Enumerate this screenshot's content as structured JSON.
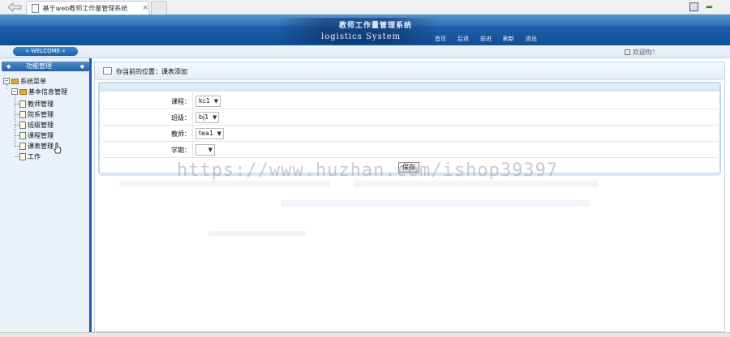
{
  "browser": {
    "tab_title": "基于web教师工作量管理系统",
    "tab_close": "×"
  },
  "header": {
    "title": "教师工作量管理系统",
    "subtitle": "logistics System",
    "nav": [
      "首页",
      "后退",
      "前进",
      "刷新",
      "退出"
    ]
  },
  "welcome": {
    "pill": "» WELCOME «",
    "greeting": "欢迎你！"
  },
  "sidebar": {
    "header": "功能管理",
    "root": "系统菜单",
    "group": "基本信息管理",
    "items": [
      "教师管理",
      "院系管理",
      "班级管理",
      "课程管理",
      "课表管理",
      "工作"
    ]
  },
  "main": {
    "breadcrumb": "你当前的位置：课表添加",
    "form": {
      "fields": [
        {
          "label": "课程：",
          "value": "kc1"
        },
        {
          "label": "班级：",
          "value": "bj1"
        },
        {
          "label": "教师：",
          "value": "tea1"
        },
        {
          "label": "学期：",
          "value": ""
        }
      ],
      "save_label": "保存"
    }
  },
  "watermark": "https://www.huzhan.com/ishop39397",
  "colors": {
    "header_blue": "#1d5ea6",
    "panel_bg": "#eaf1f9"
  }
}
